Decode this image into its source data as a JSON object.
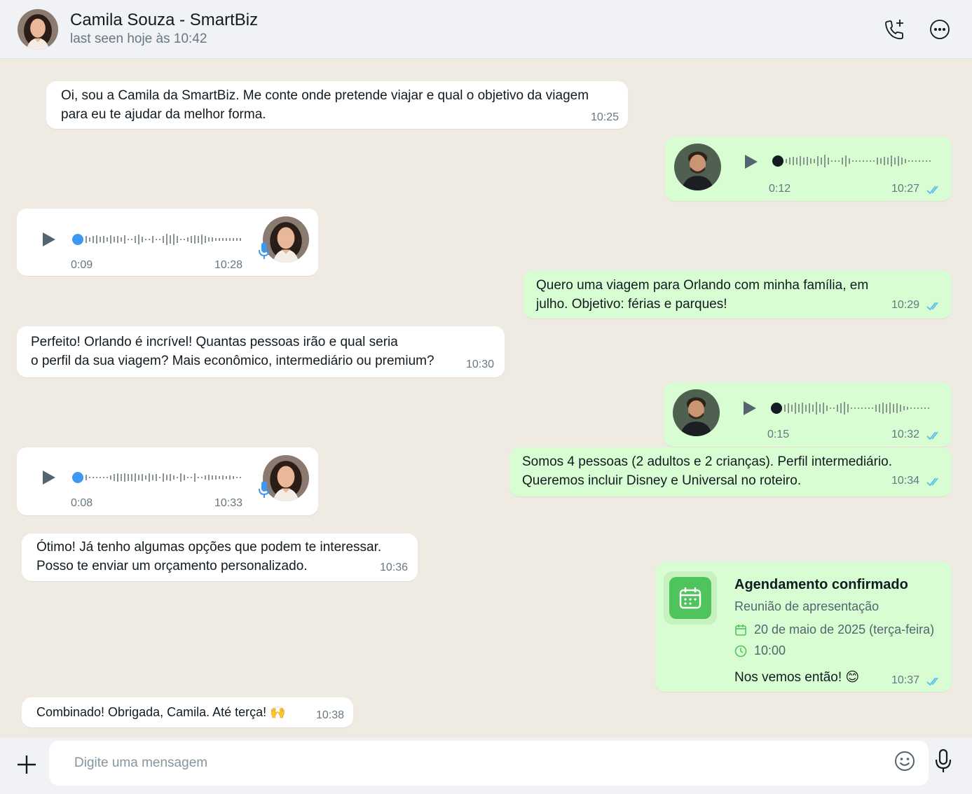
{
  "header": {
    "name": "Camila Souza - SmartBiz",
    "status": "last seen hoje às 10:42"
  },
  "messages": [
    {
      "side": "in",
      "type": "text",
      "text": "Oi, sou a Camila da SmartBiz. Me conte onde pretende viajar e qual o objetivo da viagem\npara eu te ajudar da melhor forma.",
      "time": "10:25"
    },
    {
      "side": "out",
      "type": "voice",
      "duration": "0:12",
      "time": "10:27"
    },
    {
      "side": "in",
      "type": "voice",
      "duration": "0:09",
      "time": "10:28"
    },
    {
      "side": "out",
      "type": "text",
      "text": "Quero uma viagem para Orlando com minha família, em\njulho. Objetivo: férias e parques!",
      "time": "10:29"
    },
    {
      "side": "in",
      "type": "text",
      "text": "Perfeito! Orlando é incrível! Quantas pessoas irão e qual seria\no perfil da sua viagem? Mais econômico, intermediário ou premium?",
      "time": "10:30"
    },
    {
      "side": "out",
      "type": "voice",
      "duration": "0:15",
      "time": "10:32"
    },
    {
      "side": "in",
      "type": "voice",
      "duration": "0:08",
      "time": "10:33"
    },
    {
      "side": "out",
      "type": "text",
      "text": "Somos 4 pessoas (2 adultos e 2 crianças). Perfil intermediário.\nQueremos incluir Disney e Universal no roteiro.",
      "time": "10:34"
    },
    {
      "side": "in",
      "type": "text",
      "text": "Ótimo! Já tenho algumas opções que podem te interessar.\nPosso te enviar um orçamento personalizado.",
      "time": "10:36"
    },
    {
      "side": "out",
      "type": "schedule",
      "title": "Agendamento confirmado",
      "subtitle": "Reunião de apresentação",
      "date": "20 de maio de 2025 (terça-feira)",
      "hour": "10:00",
      "note": "Nos vemos então! 😊",
      "time": "10:37"
    },
    {
      "side": "in",
      "type": "text",
      "text": "Combinado! Obrigada, Camila. Até terça! 🙌",
      "time": "10:38"
    }
  ],
  "input": {
    "placeholder": "Digite uma mensagem"
  },
  "colors": {
    "incoming": "#ffffff",
    "outgoing": "#d9fdd3",
    "read_ticks": "#53bdeb",
    "accent_green": "#4fc45c"
  }
}
